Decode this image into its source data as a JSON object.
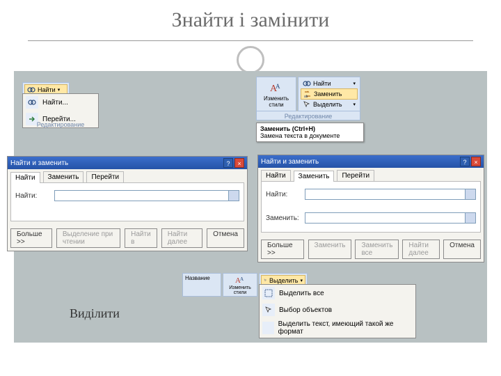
{
  "slide": {
    "title": "Знайти і замінити",
    "caption_select": "Виділити"
  },
  "find_dropdown": {
    "button": "Найти",
    "item_find": "Найти...",
    "item_goto": "Перейти...",
    "group_label": "Редактирование"
  },
  "ribbon_right": {
    "change_styles": "Изменить стили",
    "find": "Найти",
    "replace": "Заменить",
    "select": "Выделить",
    "group_label": "Редактирование",
    "tooltip_title": "Заменить (Ctrl+H)",
    "tooltip_body": "Замена текста в документе"
  },
  "dialog_find": {
    "title": "Найти и заменить",
    "tab_find": "Найти",
    "tab_replace": "Заменить",
    "tab_goto": "Перейти",
    "label_find": "Найти:",
    "btn_more": "Больше >>",
    "btn_highlight": "Выделение при чтении",
    "btn_findin": "Найти в",
    "btn_findnext": "Найти далее",
    "btn_cancel": "Отмена"
  },
  "dialog_replace": {
    "title": "Найти и заменить",
    "tab_find": "Найти",
    "tab_replace": "Заменить",
    "tab_goto": "Перейти",
    "label_find": "Найти:",
    "label_replace": "Заменить:",
    "btn_more": "Больше >>",
    "btn_replace": "Заменить",
    "btn_replaceall": "Заменить все",
    "btn_findnext": "Найти далее",
    "btn_cancel": "Отмена"
  },
  "ribbon_bottom": {
    "name": "Название",
    "change_styles": "Изменить стили",
    "select": "Выделить",
    "item_all": "Выделить все",
    "item_objects": "Выбор объектов",
    "item_similar": "Выделить текст, имеющий такой же формат"
  }
}
